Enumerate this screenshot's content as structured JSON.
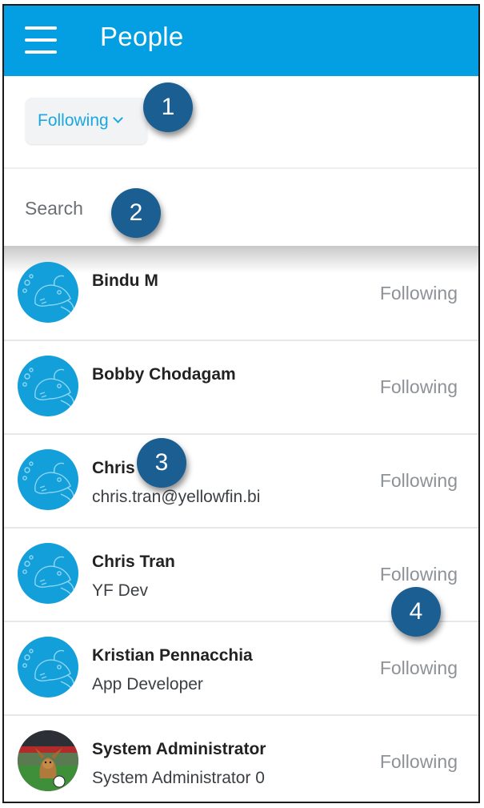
{
  "header": {
    "title": "People",
    "menu_icon": "hamburger-icon",
    "background": "#039fe2"
  },
  "filter": {
    "label": "Following",
    "icon": "chevron-down-icon",
    "color": "#1aa7e4"
  },
  "search": {
    "placeholder": "Search"
  },
  "people": [
    {
      "name": "Bindu M",
      "subtitle": "",
      "status": "Following",
      "avatar": "fish-avatar-icon"
    },
    {
      "name": "Bobby Chodagam",
      "subtitle": "",
      "status": "Following",
      "avatar": "fish-avatar-icon"
    },
    {
      "name": "Chris",
      "subtitle": "chris.tran@yellowfin.bi",
      "status": "Following",
      "avatar": "fish-avatar-icon"
    },
    {
      "name": "Chris Tran",
      "subtitle": "YF Dev",
      "status": "Following",
      "avatar": "fish-avatar-icon"
    },
    {
      "name": "Kristian Pennacchia",
      "subtitle": "App Developer",
      "status": "Following",
      "avatar": "fish-avatar-icon"
    },
    {
      "name": "System Administrator",
      "subtitle": "System Administrator 0",
      "status": "Following",
      "avatar": "dog-photo-avatar"
    }
  ],
  "callouts": [
    "1",
    "2",
    "3",
    "4"
  ]
}
